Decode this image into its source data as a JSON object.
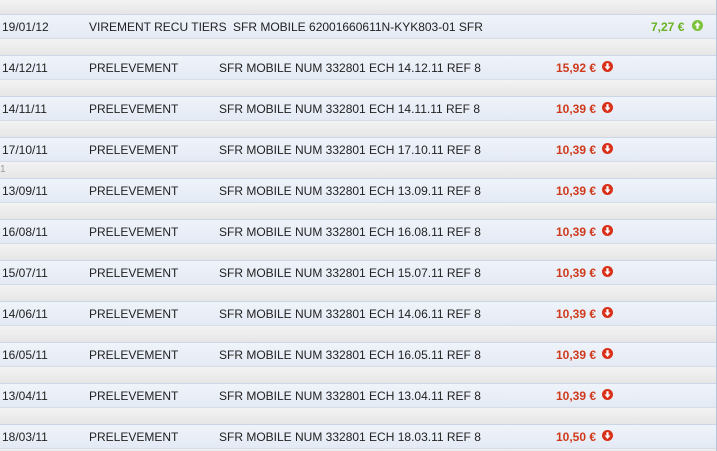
{
  "transactions": [
    {
      "date": "19/01/12",
      "type": "VIREMENT RECU TIERS",
      "label": "SFR MOBILE 62001660611N-KYK803-01 SFR",
      "amount": "7,27 €",
      "direction": "credit",
      "icon": "up-arrow-icon"
    },
    {
      "date": "14/12/11",
      "type": "PRELEVEMENT",
      "label": "SFR MOBILE NUM 332801 ECH 14.12.11 REF 8",
      "amount": "15,92 €",
      "direction": "debit",
      "icon": "down-arrow-icon"
    },
    {
      "date": "14/11/11",
      "type": "PRELEVEMENT",
      "label": "SFR MOBILE NUM 332801 ECH 14.11.11 REF 8",
      "amount": "10,39 €",
      "direction": "debit",
      "icon": "down-arrow-icon"
    },
    {
      "date": "17/10/11",
      "type": "PRELEVEMENT",
      "label": "SFR MOBILE NUM 332801 ECH 17.10.11 REF 8",
      "amount": "10,39 €",
      "direction": "debit",
      "icon": "down-arrow-icon"
    },
    {
      "date": "13/09/11",
      "type": "PRELEVEMENT",
      "label": "SFR MOBILE NUM 332801 ECH 13.09.11 REF 8",
      "amount": "10,39 €",
      "direction": "debit",
      "icon": "down-arrow-icon"
    },
    {
      "date": "16/08/11",
      "type": "PRELEVEMENT",
      "label": "SFR MOBILE NUM 332801 ECH 16.08.11 REF 8",
      "amount": "10,39 €",
      "direction": "debit",
      "icon": "down-arrow-icon"
    },
    {
      "date": "15/07/11",
      "type": "PRELEVEMENT",
      "label": "SFR MOBILE NUM 332801 ECH 15.07.11 REF 8",
      "amount": "10,39 €",
      "direction": "debit",
      "icon": "down-arrow-icon"
    },
    {
      "date": "14/06/11",
      "type": "PRELEVEMENT",
      "label": "SFR MOBILE NUM 332801 ECH 14.06.11 REF 8",
      "amount": "10,39 €",
      "direction": "debit",
      "icon": "down-arrow-icon"
    },
    {
      "date": "16/05/11",
      "type": "PRELEVEMENT",
      "label": "SFR MOBILE NUM 332801 ECH 16.05.11 REF 8",
      "amount": "10,39 €",
      "direction": "debit",
      "icon": "down-arrow-icon"
    },
    {
      "date": "13/04/11",
      "type": "PRELEVEMENT",
      "label": "SFR MOBILE NUM 332801 ECH 13.04.11 REF 8",
      "amount": "10,39 €",
      "direction": "debit",
      "icon": "down-arrow-icon"
    },
    {
      "date": "18/03/11",
      "type": "PRELEVEMENT",
      "label": "SFR MOBILE NUM 332801 ECH 18.03.11 REF 8",
      "amount": "10,50 €",
      "direction": "debit",
      "icon": "down-arrow-icon"
    }
  ],
  "side_marker": "1",
  "colors": {
    "debit": "#cf3a1c",
    "credit": "#6ab123",
    "row_background": "#eef2f9"
  }
}
